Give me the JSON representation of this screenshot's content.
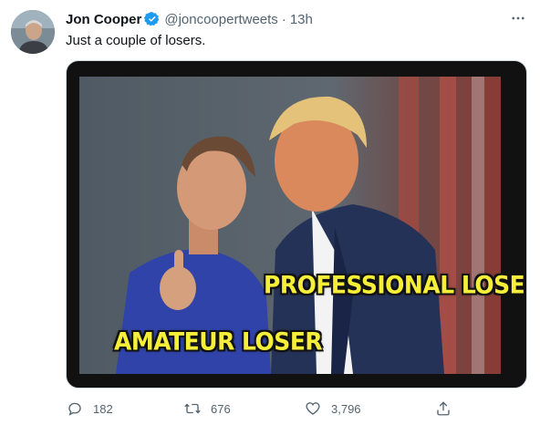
{
  "author": {
    "display_name": "Jon Cooper",
    "handle": "@joncoopertweets",
    "separator": "·",
    "time": "13h",
    "verified": true
  },
  "tweet": {
    "text": "Just a couple of losers.",
    "more_icon": "more-horizontal-icon"
  },
  "media": {
    "labels": {
      "professional": "PROFESSIONAL LOSER",
      "amateur": "AMATEUR LOSER"
    },
    "label_color": "#f5ef3a"
  },
  "actions": {
    "reply": {
      "icon": "reply-icon",
      "count": "182"
    },
    "retweet": {
      "icon": "retweet-icon",
      "count": "676"
    },
    "like": {
      "icon": "heart-icon",
      "count": "3,796"
    },
    "share": {
      "icon": "share-icon"
    }
  },
  "colors": {
    "text_primary": "#0f1419",
    "text_secondary": "#536471",
    "verified_blue": "#1d9bf0"
  }
}
